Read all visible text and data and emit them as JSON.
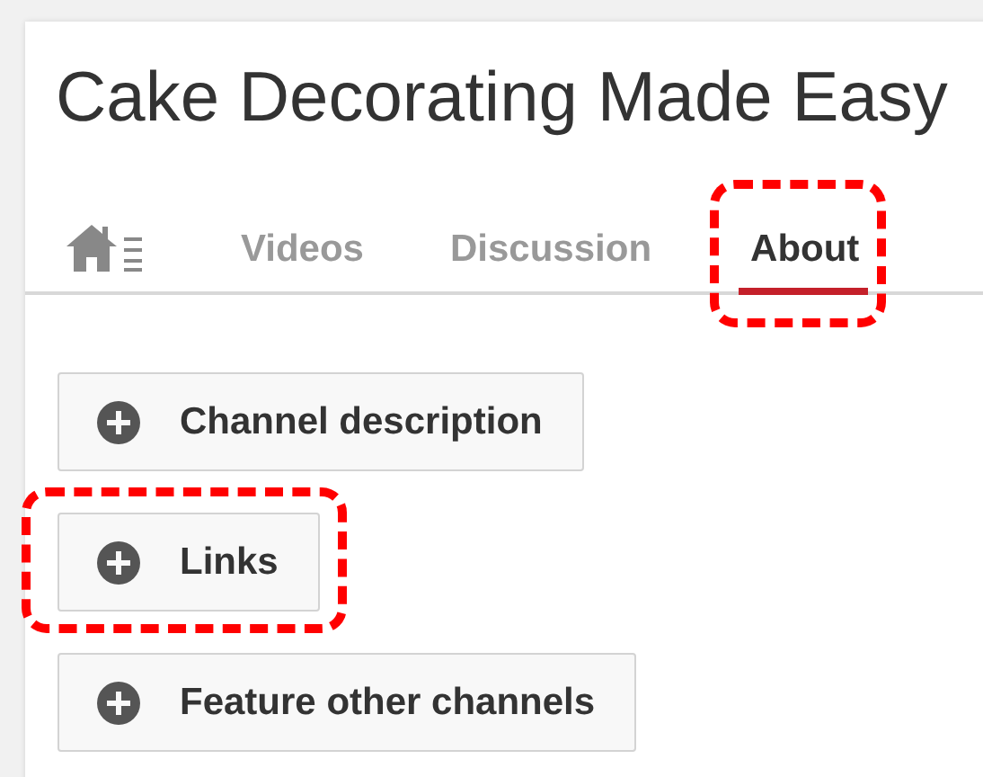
{
  "channel": {
    "title": "Cake Decorating Made Easy"
  },
  "tabs": [
    {
      "kind": "home",
      "selected": false,
      "highlighted": false
    },
    {
      "kind": "text",
      "label": "Videos",
      "selected": false,
      "highlighted": false
    },
    {
      "kind": "text",
      "label": "Discussion",
      "selected": false,
      "highlighted": false
    },
    {
      "kind": "text",
      "label": "About",
      "selected": true,
      "highlighted": true
    }
  ],
  "sections": [
    {
      "label": "Channel description",
      "highlighted": false
    },
    {
      "label": "Links",
      "highlighted": true
    },
    {
      "label": "Feature other channels",
      "highlighted": false
    }
  ]
}
